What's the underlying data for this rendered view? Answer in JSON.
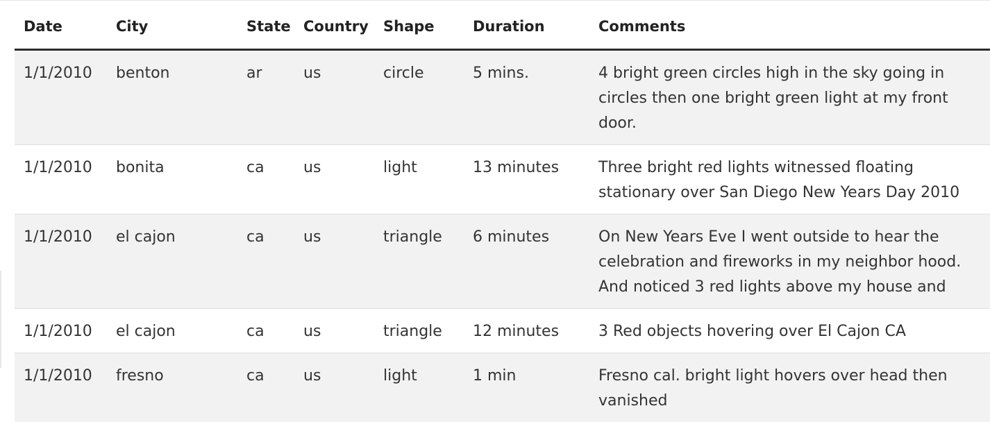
{
  "table": {
    "headers": [
      "Date",
      "City",
      "State",
      "Country",
      "Shape",
      "Duration",
      "Comments"
    ],
    "rows": [
      [
        "1/1/2010",
        "benton",
        "ar",
        "us",
        "circle",
        "5 mins.",
        "4 bright green circles high in the sky going in circles then one bright green light at my front door."
      ],
      [
        "1/1/2010",
        "bonita",
        "ca",
        "us",
        "light",
        "13 minutes",
        "Three bright red lights witnessed floating stationary over San Diego New Years Day 2010"
      ],
      [
        "1/1/2010",
        "el cajon",
        "ca",
        "us",
        "triangle",
        "6 minutes",
        "On New Years Eve I went outside to hear the celebration and fireworks in my neighbor hood. And noticed 3 red lights above my house and"
      ],
      [
        "1/1/2010",
        "el cajon",
        "ca",
        "us",
        "triangle",
        "12 minutes",
        "3 Red objects hovering over El Cajon CA"
      ],
      [
        "1/1/2010",
        "fresno",
        "ca",
        "us",
        "light",
        "1 min",
        "Fresno cal. bright light hovers over head then vanished"
      ]
    ]
  }
}
